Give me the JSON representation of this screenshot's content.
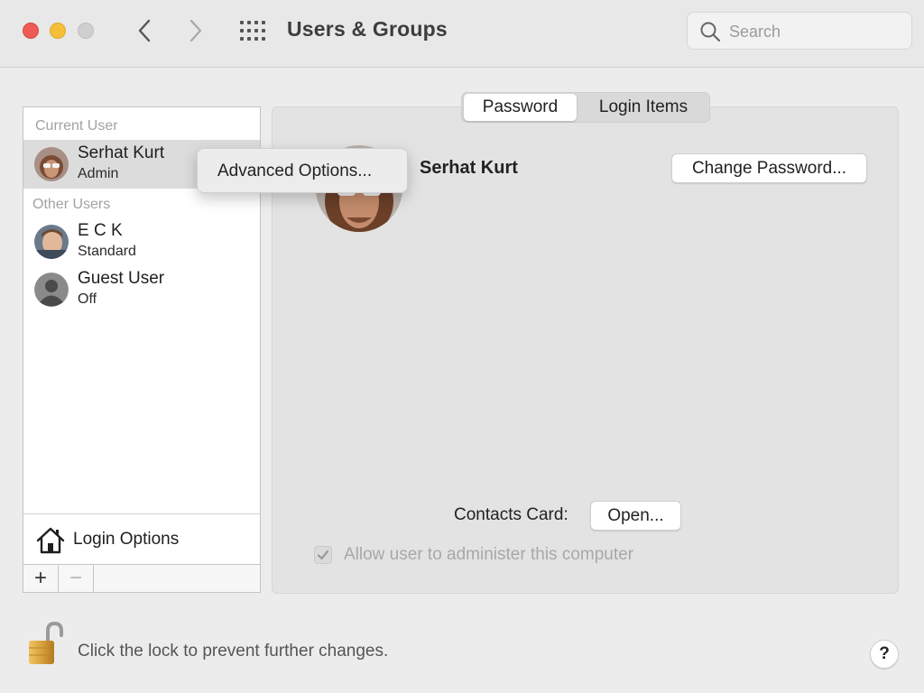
{
  "window": {
    "title": "Users & Groups"
  },
  "search": {
    "placeholder": "Search",
    "value": ""
  },
  "sidebar": {
    "current_user_label": "Current User",
    "other_users_label": "Other Users",
    "users": [
      {
        "name": "Serhat Kurt",
        "role": "Admin",
        "selected": true
      },
      {
        "name": "E C K",
        "role": "Standard"
      },
      {
        "name": "Guest User",
        "role": "Off"
      }
    ],
    "login_options_label": "Login Options",
    "add_label": "+",
    "remove_label": "−"
  },
  "context_menu": {
    "items": [
      "Advanced Options..."
    ]
  },
  "tabs": [
    {
      "label": "Password",
      "active": true
    },
    {
      "label": "Login Items",
      "active": false
    }
  ],
  "profile": {
    "name": "Serhat Kurt",
    "change_password_label": "Change Password...",
    "contacts_card_label": "Contacts Card:",
    "open_label": "Open...",
    "admin_checkbox_label": "Allow user to administer this computer",
    "admin_checked": true
  },
  "footer": {
    "lock_text": "Click the lock to prevent further changes.",
    "help_label": "?"
  },
  "colors": {
    "close": "#ee5b55",
    "minimize": "#f5bf38",
    "zoom": "#cfcfcf",
    "selection": "#dcdcdc",
    "lock_gold": "#d9a13a"
  }
}
